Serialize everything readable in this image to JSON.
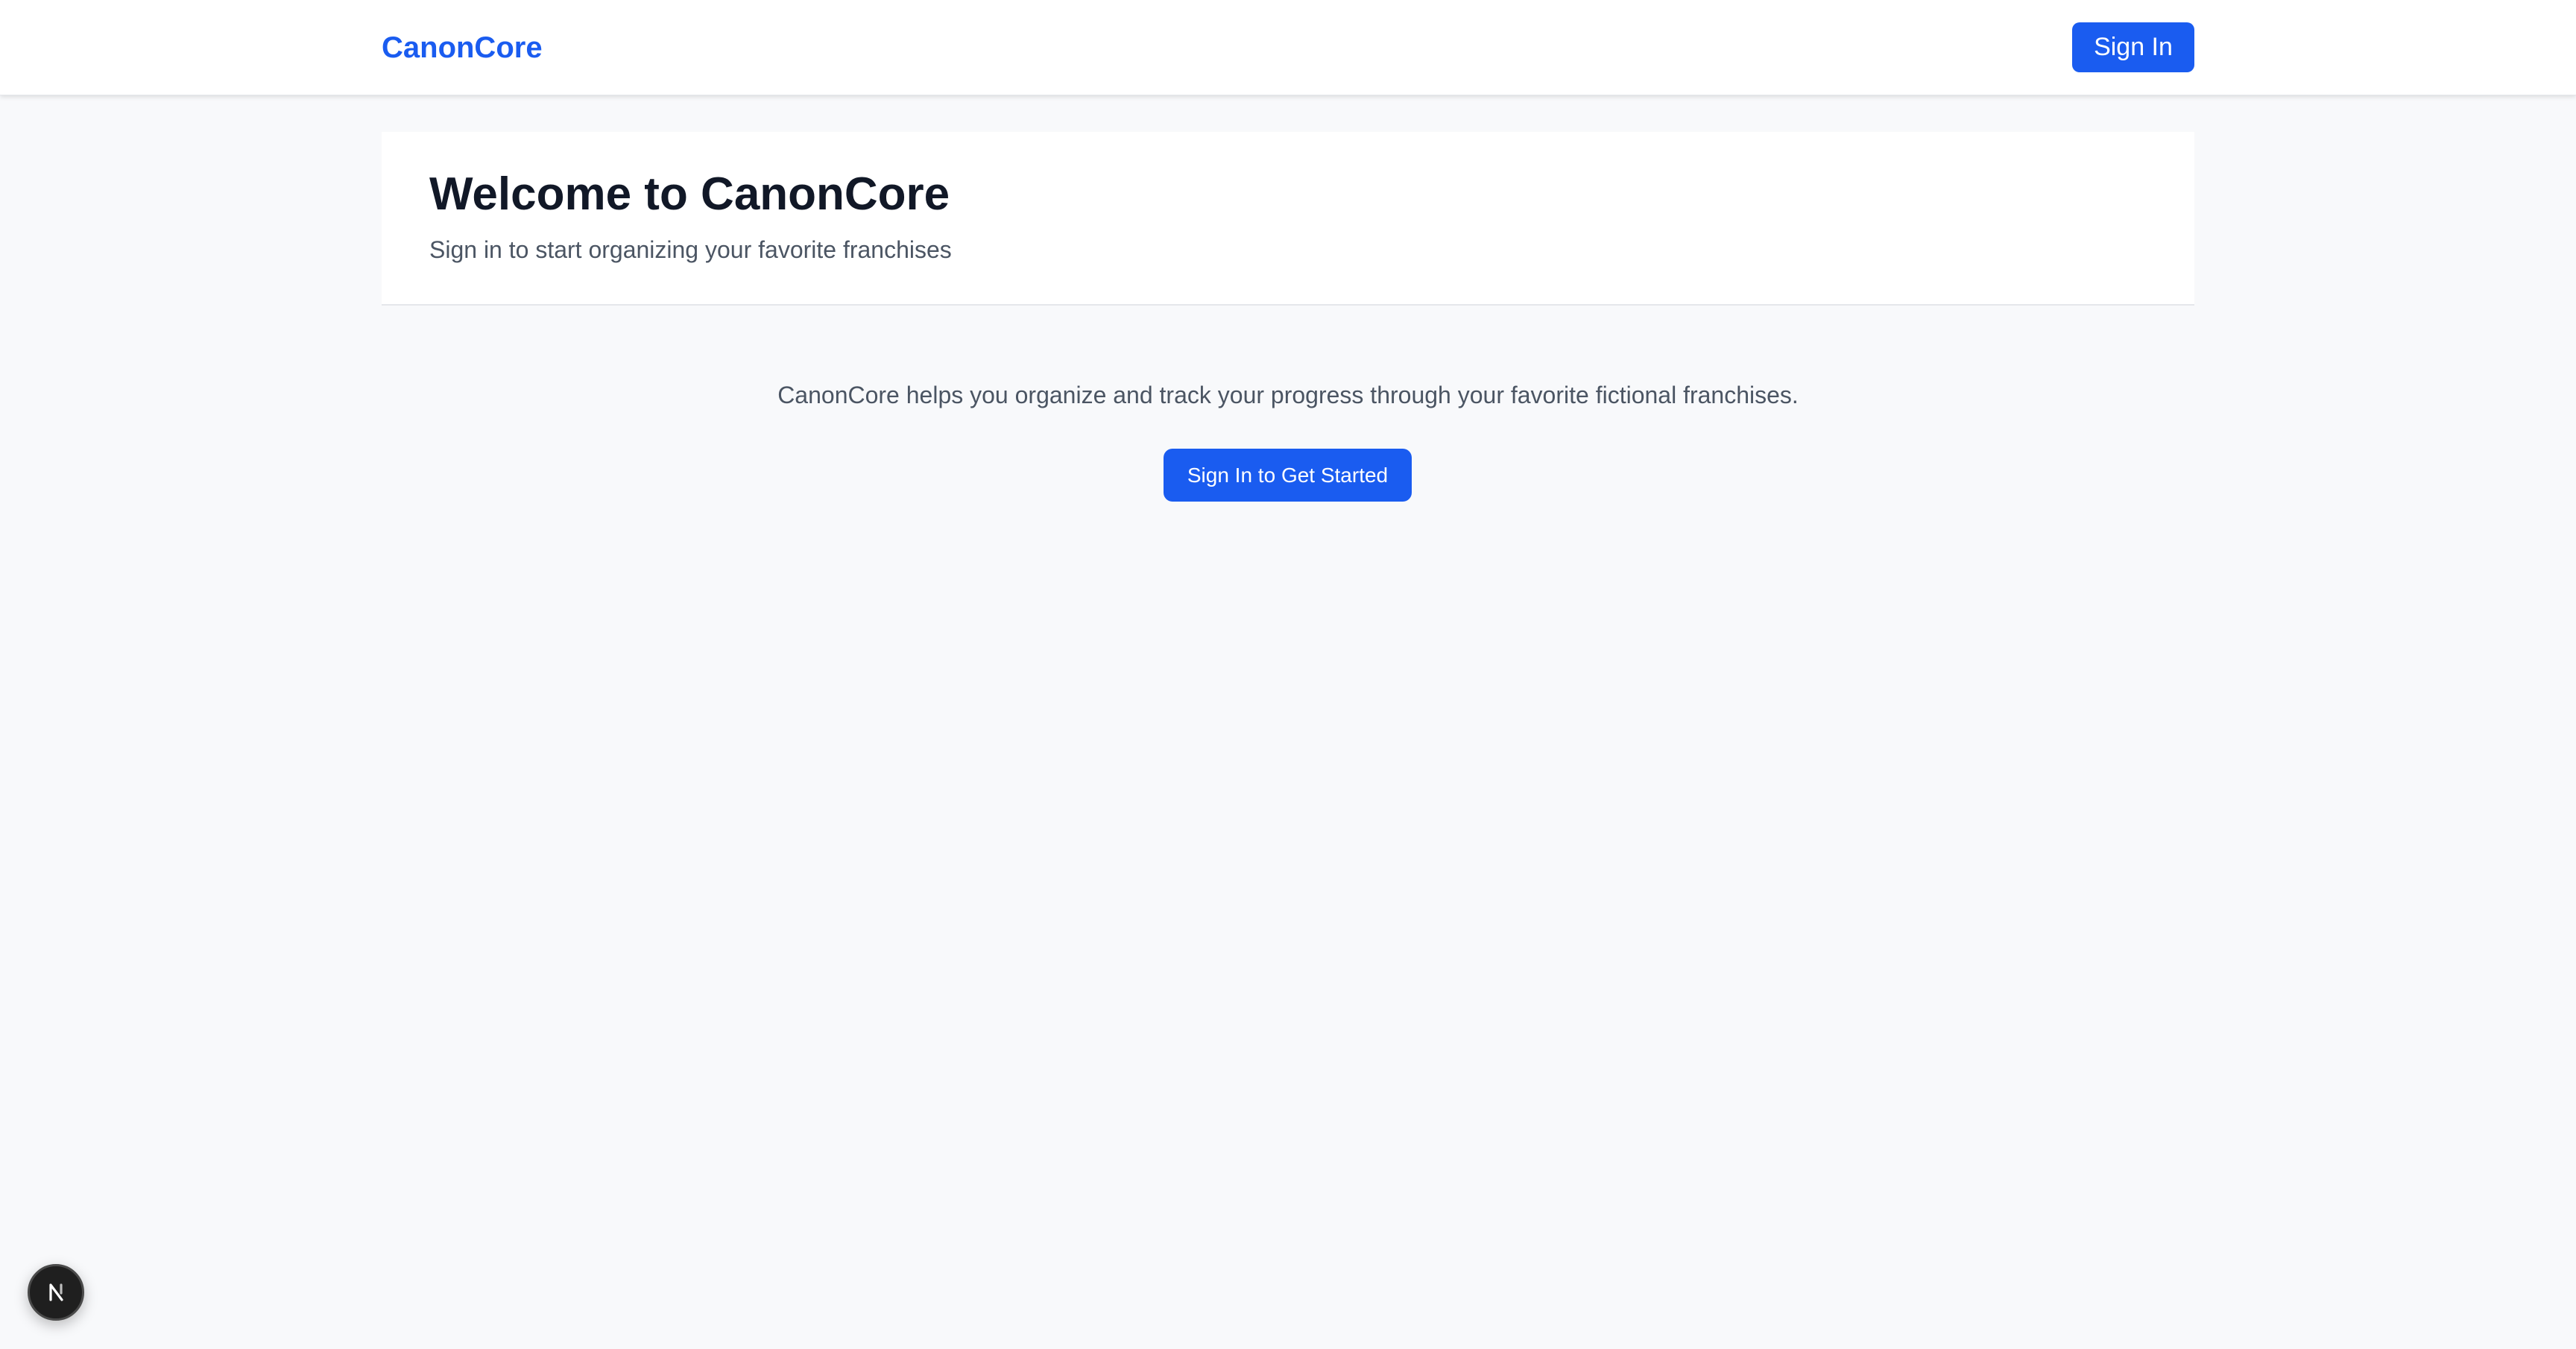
{
  "header": {
    "brand": "CanonCore",
    "sign_in_label": "Sign In"
  },
  "hero": {
    "title": "Welcome to CanonCore",
    "subtitle": "Sign in to start organizing your favorite franchises"
  },
  "main": {
    "description": "CanonCore helps you organize and track your progress through your favorite fictional franchises.",
    "cta_label": "Sign In to Get Started"
  },
  "dev_badge": {
    "icon": "nextjs-logo-icon"
  },
  "colors": {
    "accent": "#1a5cf0",
    "page_background": "#f8f9fb",
    "heading": "#111827",
    "muted_text": "#4b5563"
  }
}
